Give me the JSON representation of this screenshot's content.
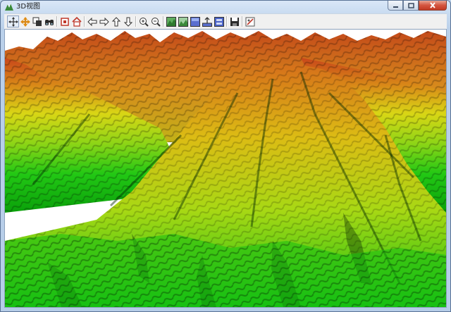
{
  "window": {
    "title": "3D视图"
  },
  "toolbar": {
    "buttons": [
      {
        "name": "pan-tool-button",
        "icon": "move-arrows-icon",
        "tooltip": ""
      },
      {
        "name": "move-orange-button",
        "icon": "move-orange-icon"
      },
      {
        "name": "copy-button",
        "icon": "copy-icon"
      },
      {
        "name": "fly-button",
        "icon": "binoculars-icon"
      },
      {
        "name": "full-extent-button",
        "icon": "full-extent-icon"
      },
      {
        "name": "home-button",
        "icon": "home-icon"
      },
      {
        "name": "rotate-left-button",
        "icon": "arrow-left-icon"
      },
      {
        "name": "rotate-right-button",
        "icon": "arrow-right-icon"
      },
      {
        "name": "tilt-up-button",
        "icon": "arrow-up-icon"
      },
      {
        "name": "tilt-down-button",
        "icon": "arrow-down-icon"
      },
      {
        "name": "zoom-in-button",
        "icon": "zoom-in-icon"
      },
      {
        "name": "zoom-out-button",
        "icon": "zoom-out-icon"
      },
      {
        "name": "terrain-render-button",
        "icon": "terrain-icon"
      },
      {
        "name": "terrain-shade-button",
        "icon": "terrain-shade-icon"
      },
      {
        "name": "texture-button",
        "icon": "texture-icon"
      },
      {
        "name": "elevation-scale-button",
        "icon": "elevation-icon"
      },
      {
        "name": "layer-settings-button",
        "icon": "layer-icon"
      },
      {
        "name": "save-button",
        "icon": "save-icon"
      },
      {
        "name": "settings-button",
        "icon": "settings-icon"
      }
    ]
  },
  "colors": {
    "terrain_low": "#10c010",
    "terrain_mid": "#d8dc10",
    "terrain_high": "#d0501a",
    "sky": "#ffffff"
  }
}
